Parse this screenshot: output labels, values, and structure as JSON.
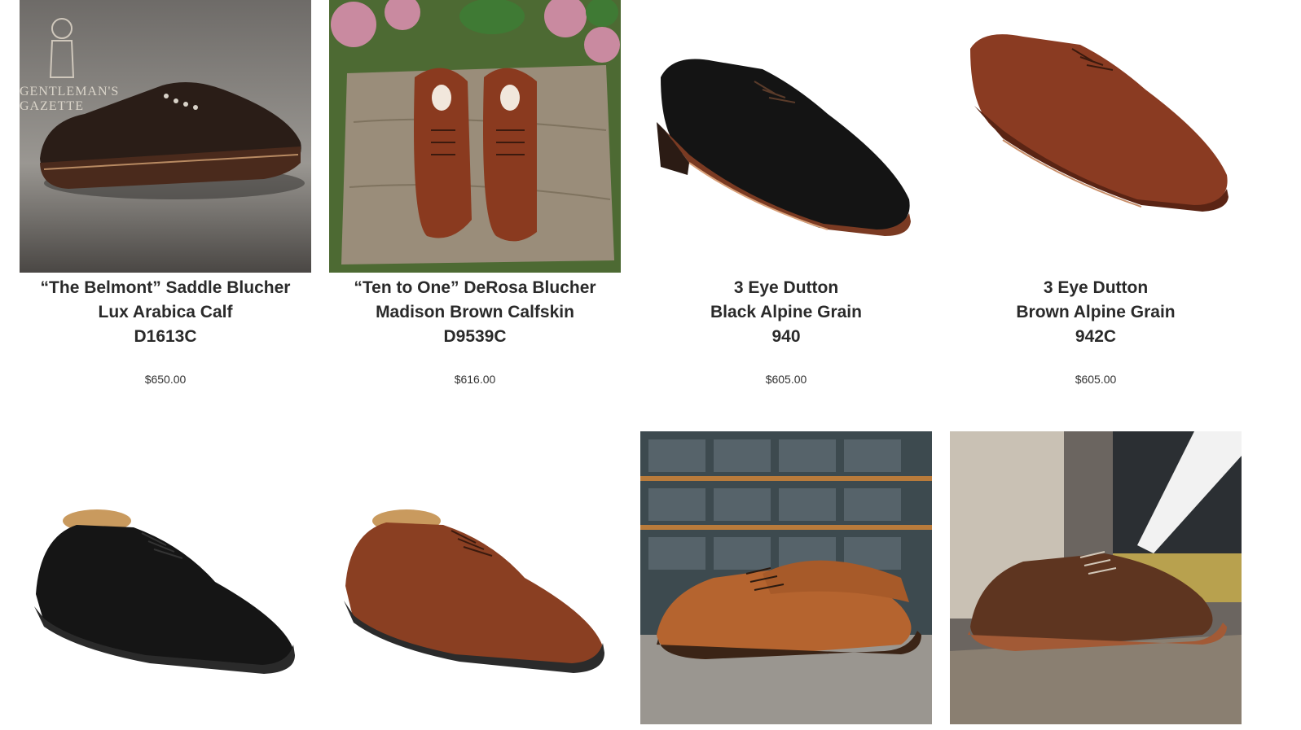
{
  "products_row1": [
    {
      "image_icon": "shoe-photo-belmont",
      "watermark": "GENTLEMAN'S GAZETTE",
      "title_lines": [
        "“The Belmont” Saddle Blucher",
        "Lux Arabica Calf",
        "D1613C"
      ],
      "price": "$650.00"
    },
    {
      "image_icon": "shoe-photo-ten-to-one",
      "title_lines": [
        "“Ten to One” DeRosa Blucher",
        "Madison Brown Calfskin",
        "D9539C"
      ],
      "price": "$616.00"
    },
    {
      "image_icon": "shoe-photo-dutton-black",
      "title_lines": [
        "3 Eye Dutton",
        "Black Alpine Grain",
        "940"
      ],
      "price": "$605.00"
    },
    {
      "image_icon": "shoe-photo-dutton-brown",
      "title_lines": [
        "3 Eye Dutton",
        "Brown Alpine Grain",
        "942C"
      ],
      "price": "$605.00"
    }
  ],
  "products_row2": [
    {
      "image_icon": "shoe-photo-black-plain-toe"
    },
    {
      "image_icon": "shoe-photo-brown-plain-toe"
    },
    {
      "image_icon": "shoe-photo-tan-split-toe-warehouse"
    },
    {
      "image_icon": "shoe-photo-brown-split-toe-subway"
    }
  ]
}
